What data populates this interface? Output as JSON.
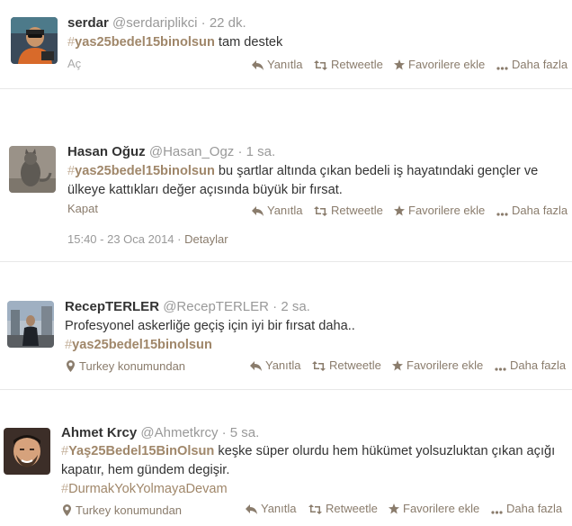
{
  "actions": {
    "reply": "Yanıtla",
    "retweet": "Retweetle",
    "favorite": "Favorilere ekle",
    "more": "Daha fazla"
  },
  "colors": {
    "hashtag": "#a0876a",
    "action": "#8a7c6c",
    "muted": "#999999",
    "text": "#333333"
  },
  "tweets": [
    {
      "name": "serdar",
      "handle": "@serdariplikci",
      "sep": "·",
      "time": "22 dk.",
      "text_parts": {
        "hashtag_hash": "#",
        "hashtag": "yas25bedel15binolsun",
        "rest": " tam destek"
      },
      "toggle": "Aç"
    },
    {
      "name": "Hasan Oğuz",
      "handle": "@Hasan_Ogz",
      "sep": "·",
      "time": "1 sa.",
      "text_parts": {
        "hashtag_hash": "#",
        "hashtag": "yas25bedel15binolsun",
        "rest": " bu şartlar altında çıkan bedeli iş hayatındaki gençler ve ülkeye kattıkları değer açısında büyük bir fırsat."
      },
      "toggle": "Kapat",
      "timestamp": "15:40 - 23 Oca 2014",
      "detail_sep": "·",
      "details": "Detaylar"
    },
    {
      "name": "RecepTERLER",
      "handle": "@RecepTERLER",
      "sep": "·",
      "time": "2 sa.",
      "text_parts": {
        "line1": "Profesyonel askerliğe geçiş için iyi bir fırsat daha..",
        "hashtag_hash": "#",
        "hashtag": "yas25bedel15binolsun"
      },
      "location": "Turkey konumundan"
    },
    {
      "name": "Ahmet Krcy",
      "handle": "@Ahmetkrcy",
      "sep": "·",
      "time": "5 sa.",
      "text_parts": {
        "hashtag_hash": "#",
        "hashtag": "Yaş25Bedel15BinOlsun",
        "rest": " keşke süper olurdu hem hükümet yolsuzluktan çıkan açığı kapatır, hem gündem degişir.",
        "hashtag2_hash": "#",
        "hashtag2": "DurmakYokYolmayaDevam"
      },
      "location": "Turkey konumundan"
    }
  ]
}
